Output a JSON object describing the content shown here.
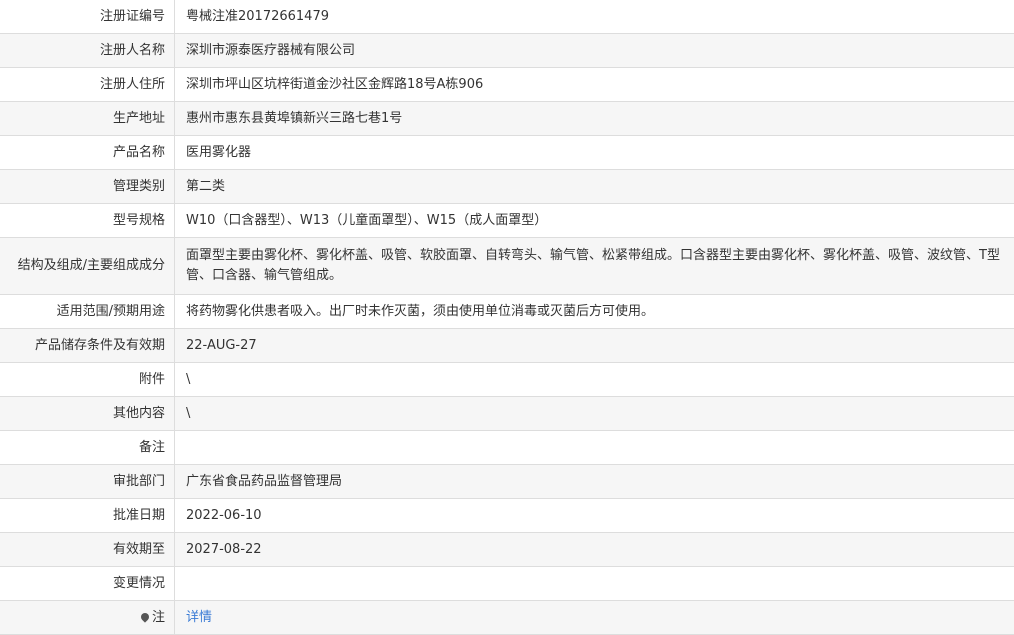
{
  "rows": [
    {
      "label": "注册证编号",
      "value": "粤械注准20172661479"
    },
    {
      "label": "注册人名称",
      "value": "深圳市源泰医疗器械有限公司"
    },
    {
      "label": "注册人住所",
      "value": "深圳市坪山区坑梓街道金沙社区金辉路18号A栋906"
    },
    {
      "label": "生产地址",
      "value": "惠州市惠东县黄埠镇新兴三路七巷1号"
    },
    {
      "label": "产品名称",
      "value": "医用雾化器"
    },
    {
      "label": "管理类别",
      "value": "第二类"
    },
    {
      "label": "型号规格",
      "value": "W10（口含器型）、W13（儿童面罩型）、W15（成人面罩型）"
    },
    {
      "label": "结构及组成/主要组成成分",
      "value": "面罩型主要由雾化杯、雾化杯盖、吸管、软胶面罩、自转弯头、输气管、松紧带组成。口含器型主要由雾化杯、雾化杯盖、吸管、波纹管、T型管、口含器、输气管组成。"
    },
    {
      "label": "适用范围/预期用途",
      "value": "将药物雾化供患者吸入。出厂时未作灭菌，须由使用单位消毒或灭菌后方可使用。"
    },
    {
      "label": "产品储存条件及有效期",
      "value": "22-AUG-27"
    },
    {
      "label": "附件",
      "value": "\\"
    },
    {
      "label": "其他内容",
      "value": "\\"
    },
    {
      "label": "备注",
      "value": ""
    },
    {
      "label": "审批部门",
      "value": "广东省食品药品监督管理局"
    },
    {
      "label": "批准日期",
      "value": "2022-06-10"
    },
    {
      "label": "有效期至",
      "value": "2027-08-22"
    },
    {
      "label": "变更情况",
      "value": ""
    },
    {
      "label": "注",
      "value": "详情",
      "icon": "pin-icon"
    }
  ]
}
